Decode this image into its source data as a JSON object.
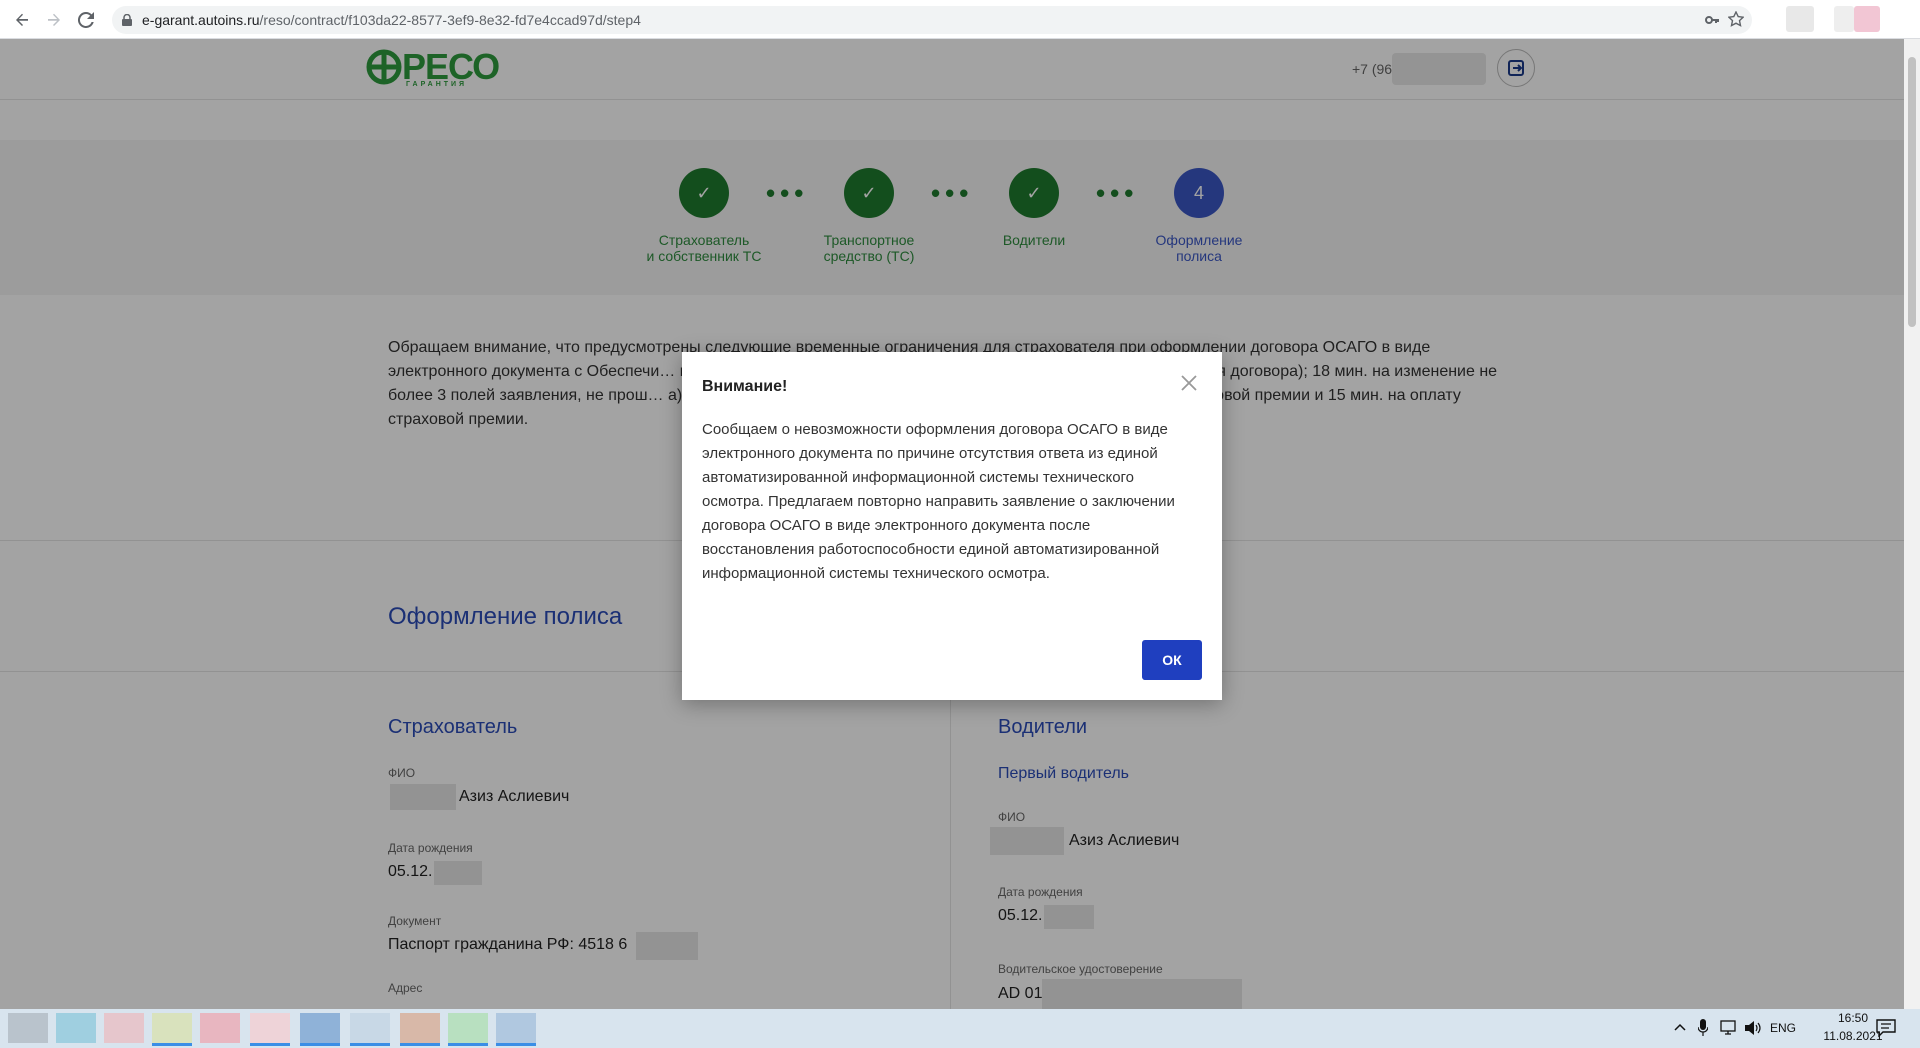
{
  "browser": {
    "url_host": "e-garant.autoins.ru",
    "url_path": "/reso/contract/f103da22-8577-3ef9-8e32-fd7e4ccad97d/step4"
  },
  "header": {
    "logo_text": "РЕСО",
    "logo_sub": "ГАРАНТИЯ",
    "phone_prefix": "+7 (96"
  },
  "steps": [
    {
      "label_1": "Страхователь",
      "label_2": "и собственник ТС",
      "mark": "✓"
    },
    {
      "label_1": "Транспортное",
      "label_2": "средство (ТС)",
      "mark": "✓"
    },
    {
      "label_1": "Водители",
      "label_2": "",
      "mark": "✓"
    },
    {
      "label_1": "Оформление",
      "label_2": "полиса",
      "mark": "4"
    }
  ],
  "notice": {
    "text": "Обращаем внимание, что предусмотрены следующие временные ограничения для страхователя при оформлении договора ОСАГО в виде электронного документа с Обеспечи… на направление заполненного заявления; 3 ч. на загрузку в личный … ия договора); 18 мин. на изменение не более 3 полей заявления, не прош… а), кроме изменения данных страхователя и адреса собственника… траховой премии и 15 мин. на оплату страховой премии."
  },
  "main": {
    "section_title": "Оформление полиса",
    "insurer": {
      "title": "Страхователь",
      "fio_label": "ФИО",
      "fio_value": "Азиз Аслиевич",
      "dob_label": "Дата рождения",
      "dob_value": "05.12.",
      "doc_label": "Документ",
      "doc_value": "Паспорт гражданина РФ: 4518 6",
      "address_label": "Адрес"
    },
    "drivers": {
      "title": "Водители",
      "first_driver": "Первый водитель",
      "fio_label": "ФИО",
      "fio_value": "Азиз Аслиевич",
      "dob_label": "Дата рождения",
      "dob_value": "05.12.",
      "license_label": "Водительское удостоверение",
      "license_value": "AD 01"
    }
  },
  "modal": {
    "title": "Внимание!",
    "body": "Сообщаем о невозможности оформления договора ОСАГО в виде электронного документа по причине отсутствия ответа из единой автоматизированной информационной системы технического осмотра. Предлагаем повторно направить заявление о заключении договора ОСАГО в виде электронного документа после восстановления работоспособности единой автоматизированной информационной системы технического осмотра.",
    "ok_label": "ОК"
  },
  "taskbar": {
    "lang": "ENG",
    "time": "16:50",
    "date": "11.08.2021"
  },
  "colors": {
    "brand_green": "#2e9c3e",
    "step_done": "#1f7a2e",
    "step_current": "#3b57c4",
    "ok_button": "#1f3fbf"
  }
}
